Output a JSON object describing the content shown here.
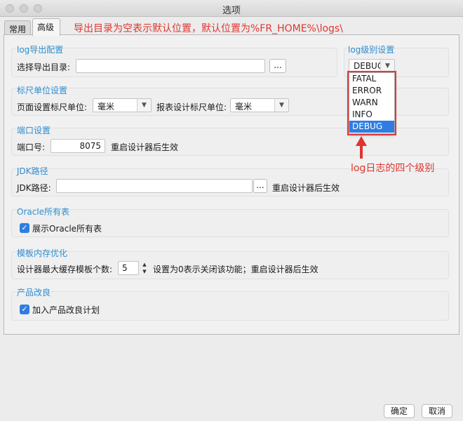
{
  "window": {
    "title": "选项"
  },
  "tabs": [
    {
      "label": "常用"
    },
    {
      "label": "高级"
    }
  ],
  "log_export": {
    "title": "log导出配置",
    "dir_label": "选择导出目录:",
    "dir_value": "",
    "browse_label": "..."
  },
  "log_level": {
    "title": "log级别设置",
    "selected": "DEBUG",
    "options": [
      "FATAL",
      "ERROR",
      "WARN",
      "INFO",
      "DEBUG"
    ]
  },
  "ruler": {
    "title": "标尺单位设置",
    "page_label": "页面设置标尺单位:",
    "page_value": "毫米",
    "report_label": "报表设计标尺单位:",
    "report_value": "毫米"
  },
  "port": {
    "title": "端口设置",
    "label": "端口号:",
    "value": "8075",
    "note": "重启设计器后生效"
  },
  "jdk": {
    "title": "JDK路径",
    "label": "JDK路径:",
    "value": "",
    "browse_label": "...",
    "note": "重启设计器后生效"
  },
  "oracle": {
    "title": "Oracle所有表",
    "checkbox_label": "展示Oracle所有表",
    "checked": true
  },
  "template_cache": {
    "title": "模板内存优化",
    "label": "设计器最大缓存模板个数:",
    "value": "5",
    "note": "设置为0表示关闭该功能；重启设计器后生效"
  },
  "product": {
    "title": "产品改良",
    "checkbox_label": "加入产品改良计划",
    "checked": true
  },
  "annotations": {
    "top": "导出目录为空表示默认位置，默认位置为%FR_HOME%\\logs\\",
    "levels": "log日志的四个级别"
  },
  "footer": {
    "ok": "确定",
    "cancel": "取消"
  },
  "colors": {
    "accent": "#2f7de1",
    "group_title": "#2f8fd3",
    "annotation": "#e0352f"
  },
  "icons": [
    "checkmark-icon",
    "chevron-down-icon",
    "spinner-up-icon",
    "spinner-down-icon",
    "arrow-up-icon",
    "arrow-down-icon"
  ]
}
